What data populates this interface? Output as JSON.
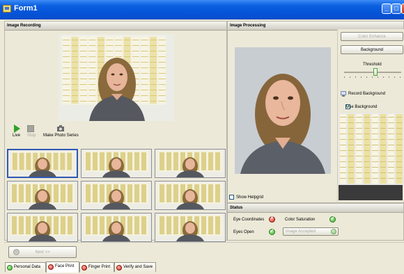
{
  "window": {
    "title": "Form1"
  },
  "recording": {
    "header": "Image Recording",
    "live_label": "Live",
    "stop_label": "Stop",
    "series_label": "Make Photo Series"
  },
  "processing": {
    "header": "Image Processing",
    "color_enhance_label": "Color Enhance",
    "background_label": "Background",
    "threshold_label": "Threshold",
    "threshold_value": 0.55,
    "record_background_label": "Record Background",
    "use_background_label": "Use Background",
    "use_background_checked": true,
    "show_helpgrid_label": "Show Helpgrid",
    "show_helpgrid_checked": false
  },
  "status": {
    "header": "Status",
    "items": [
      {
        "label": "Eye Coordinates",
        "state": "bad"
      },
      {
        "label": "Color Saturation",
        "state": "ok"
      },
      {
        "label": "Eyes Open",
        "state": "ok"
      },
      {
        "label": "Image Accepted",
        "state": "ok"
      }
    ]
  },
  "nav": {
    "next_label": "Next >>"
  },
  "tabs": [
    {
      "label": "Personal Data",
      "state": "ok"
    },
    {
      "label": "Face Print",
      "state": "bad"
    },
    {
      "label": "Finger Print",
      "state": "bad"
    },
    {
      "label": "Verify and Save",
      "state": "bad"
    }
  ],
  "colors": {
    "titlebar": "#0553d8",
    "ok": "#3fae2c",
    "bad": "#d42c20",
    "selection": "#2f57b5"
  }
}
